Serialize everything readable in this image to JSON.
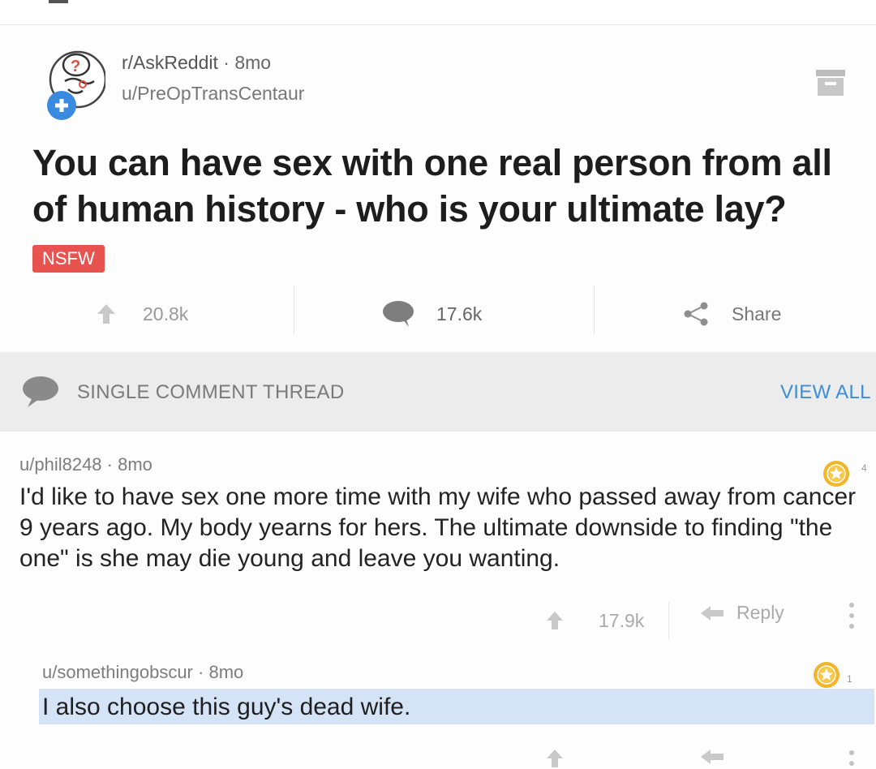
{
  "post": {
    "subreddit": "r/AskReddit",
    "separator": "·",
    "age": "8mo",
    "author": "u/PreOpTransCentaur",
    "title": "You can have sex with one real person from all of human history - who is your ultimate lay?",
    "tag": "NSFW",
    "upvotes": "20.8k",
    "comments": "17.6k",
    "share_label": "Share"
  },
  "thread": {
    "label": "SINGLE COMMENT THREAD",
    "view_all": "VIEW ALL"
  },
  "comments": [
    {
      "author": "u/phil8248",
      "separator": "·",
      "age": "8mo",
      "award_count": "4",
      "body": "I'd like to have sex one more time with my wife who passed away from cancer 9 years ago. My body yearns for hers. The ultimate downside to finding \"the one\" is she may die young and leave you wanting.",
      "votes": "17.9k",
      "reply_label": "Reply"
    },
    {
      "author": "u/somethingobscur",
      "separator": "·",
      "age": "8mo",
      "award_count": "1",
      "body": "I also choose this guy's dead wife."
    }
  ],
  "colors": {
    "nsfw": "#e8534f",
    "link": "#3c8fd6",
    "award": "#f3b52a",
    "highlight": "#d4e3f6"
  },
  "icons": [
    "subreddit-avatar-icon",
    "archive-icon",
    "upvote-icon",
    "comment-icon",
    "share-icon",
    "award-icon",
    "reply-icon",
    "more-icon"
  ]
}
